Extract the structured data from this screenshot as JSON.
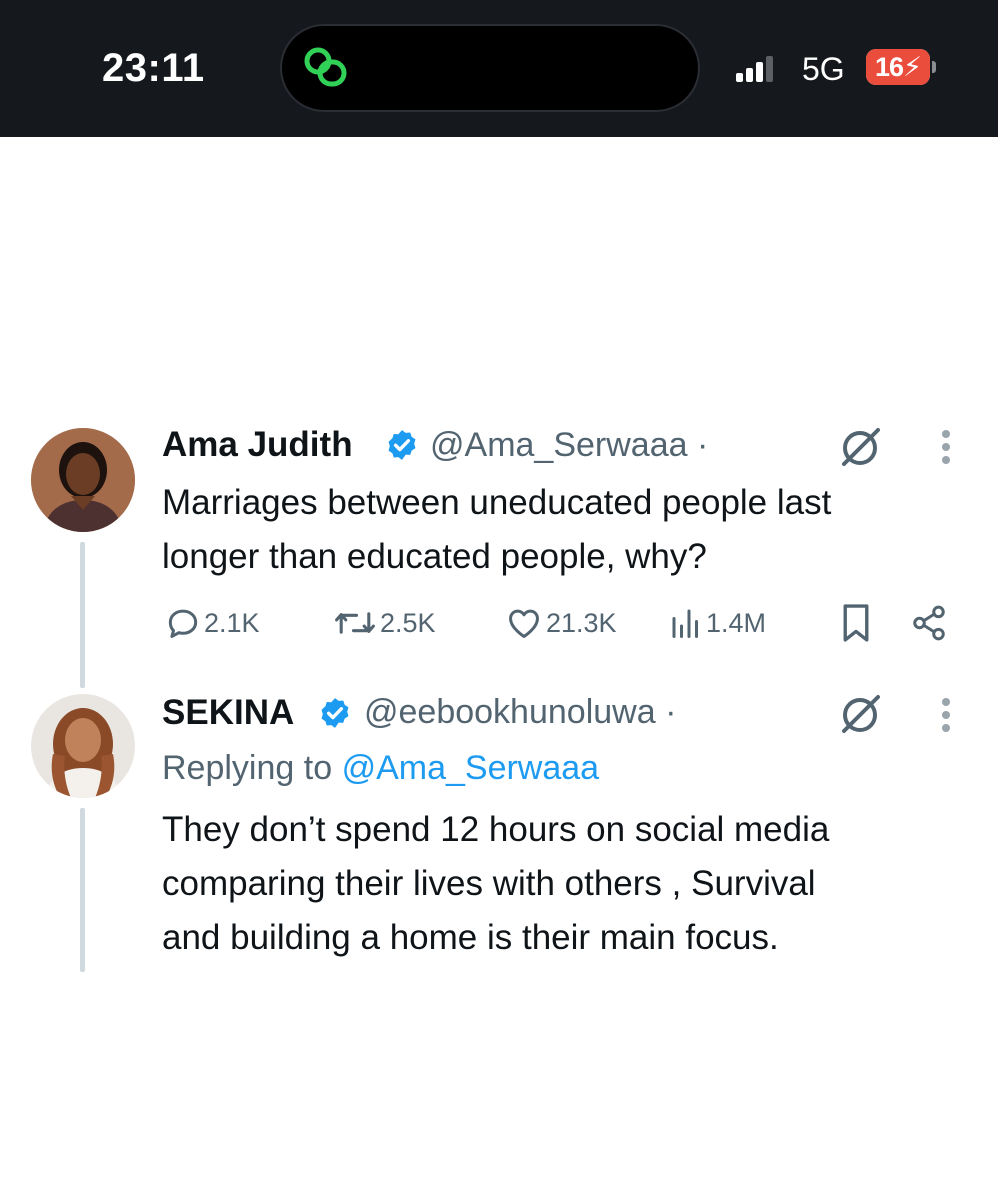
{
  "status_bar": {
    "time": "23:11",
    "network": "5G",
    "battery_level": "16",
    "battery_percent": 16,
    "charging": true,
    "signal_bars": 3,
    "icons": [
      "app-activity-icon",
      "cellular-signal-icon",
      "battery-charging-icon"
    ],
    "accent_color": "#31d158",
    "battery_color": "#eb4d3d"
  },
  "tweet": {
    "author_name": "Ama Judith",
    "author_handle": "@Ama_Serwaaa",
    "separator": "·",
    "verified": true,
    "text_lines": [
      "Marriages between uneducated people last",
      "longer than educated people, why?"
    ],
    "actions": {
      "replies": "2.1K",
      "retweets": "2.5K",
      "likes": "21.3K",
      "views": "1.4M"
    },
    "icons": [
      "verified-badge-icon",
      "grok-icon",
      "more-icon",
      "reply-icon",
      "retweet-icon",
      "like-icon",
      "views-icon",
      "bookmark-icon",
      "share-icon"
    ]
  },
  "reply": {
    "author_name": "SEKINA",
    "author_handle": "@eebookhunoluwa",
    "separator": "·",
    "verified": true,
    "replying_prefix": "Replying to",
    "replying_to": "@Ama_Serwaaa",
    "text_lines": [
      "They don’t spend 12 hours on social media",
      "comparing their lives with others , Survival",
      "and building a home is their main focus."
    ]
  },
  "colors": {
    "link": "#1d9bf0",
    "verified": "#1d9bf0",
    "muted": "#536471",
    "text": "#0f1419"
  }
}
